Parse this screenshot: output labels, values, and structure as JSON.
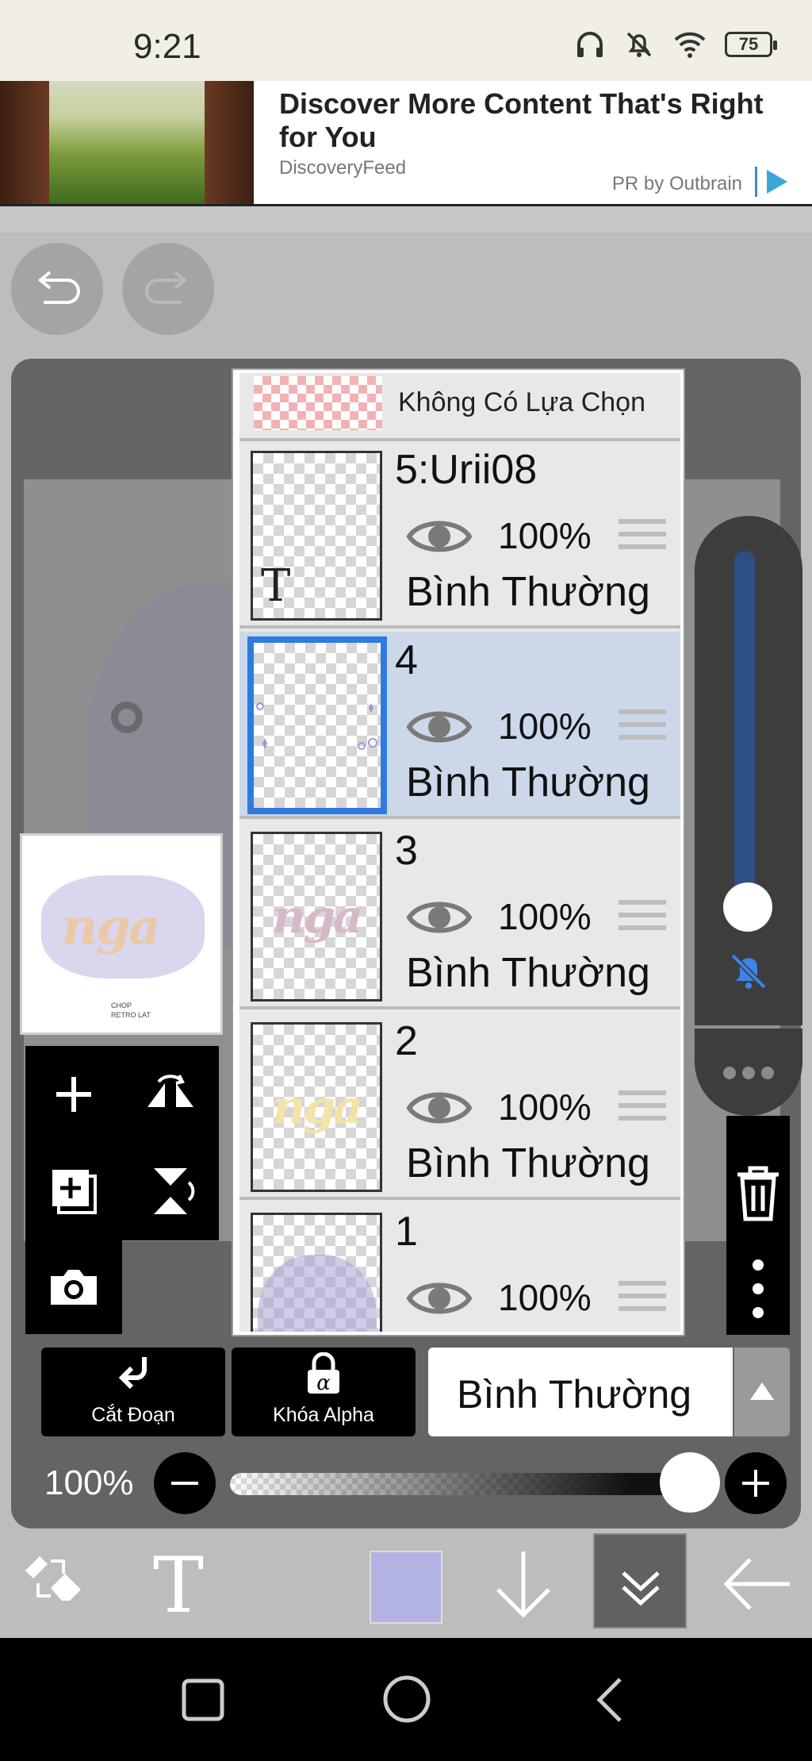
{
  "status_bar": {
    "time": "9:21",
    "battery": "75"
  },
  "ad": {
    "title": "Discover More Content That's Right for You",
    "source": "DiscoveryFeed",
    "pr": "PR by Outbrain"
  },
  "selection": {
    "label": "Không Có Lựa Chọn"
  },
  "layers": [
    {
      "name": "5:Urii08",
      "opacity": "100%",
      "blend": "Bình Thường",
      "thumb_text": "T"
    },
    {
      "name": "4",
      "opacity": "100%",
      "blend": "Bình Thường"
    },
    {
      "name": "3",
      "opacity": "100%",
      "blend": "Bình Thường",
      "thumb_text": "nga"
    },
    {
      "name": "2",
      "opacity": "100%",
      "blend": "Bình Thường",
      "thumb_text": "nga"
    },
    {
      "name": "1",
      "opacity": "100%"
    }
  ],
  "thumbnail": {
    "art_text": "nga",
    "caption_line1": "CHOP",
    "caption_line2": "RETRO LAT"
  },
  "controls": {
    "clip_label": "Cắt Đoạn",
    "alpha_lock_label": "Khóa Alpha",
    "blend_mode": "Bình Thường",
    "opacity": "100%"
  },
  "colors": {
    "accent": "#2f7ae0",
    "current_color": "#b3b3e3",
    "active_layer_bg": "#ccd8ea"
  }
}
